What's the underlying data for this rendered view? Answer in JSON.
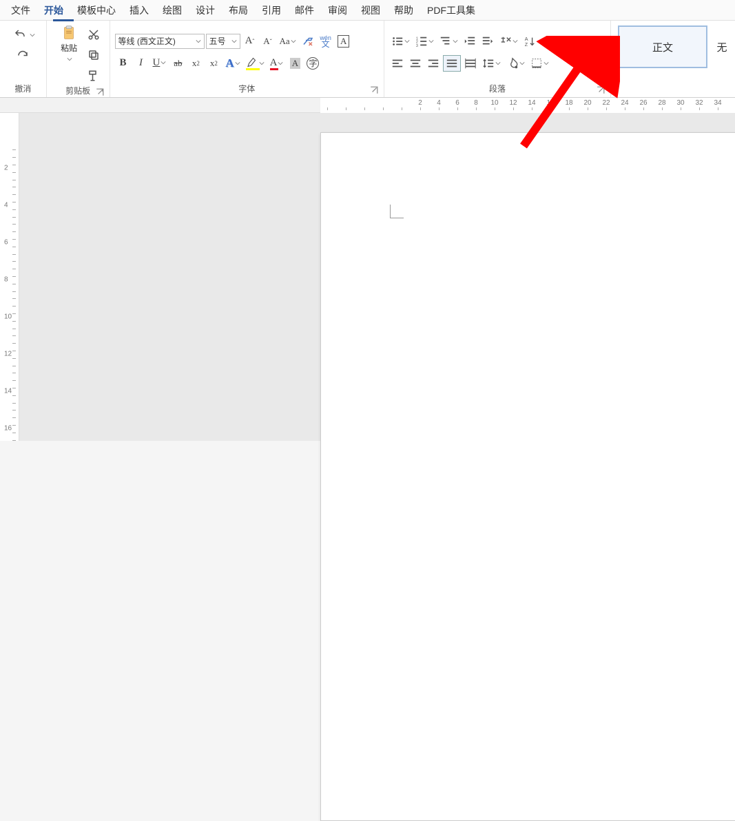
{
  "menu": {
    "items": [
      "文件",
      "开始",
      "模板中心",
      "插入",
      "绘图",
      "设计",
      "布局",
      "引用",
      "邮件",
      "审阅",
      "视图",
      "帮助",
      "PDF工具集"
    ],
    "active_index": 1
  },
  "ribbon": {
    "undo_group": {
      "label": "撤消"
    },
    "clipboard": {
      "paste_label": "粘贴",
      "label": "剪贴板"
    },
    "font": {
      "family_value": "等线 (西文正文)",
      "size_value": "五号",
      "label": "字体",
      "phonetic": "wén",
      "phonetic2": "文"
    },
    "paragraph": {
      "label": "段落"
    },
    "styles": {
      "style1": "正文",
      "style2_partial": "无"
    }
  },
  "ruler": {
    "ticks": [
      2,
      4,
      6,
      8,
      10,
      12,
      14,
      16,
      18,
      20,
      22,
      24,
      26,
      28,
      30,
      32,
      34
    ]
  },
  "vruler": {
    "ticks": [
      2,
      4,
      6,
      8,
      10,
      12,
      14,
      16
    ]
  },
  "colors": {
    "highlight": "#ffff00",
    "fontcolor": "#e81123",
    "accent": "#2b579a"
  }
}
